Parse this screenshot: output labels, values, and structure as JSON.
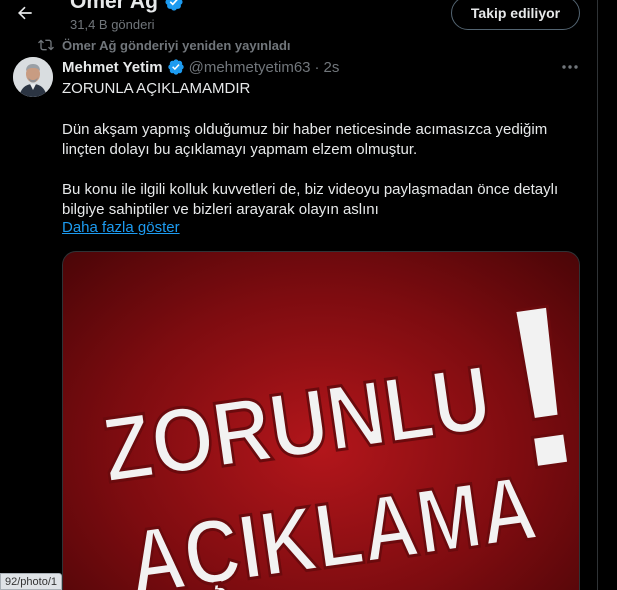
{
  "header": {
    "profile_name": "Ömer Ağ",
    "post_count": "31,4 B gönderi",
    "follow_label": "Takip ediliyor"
  },
  "repost": {
    "text": "Ömer Ağ gönderiyi yeniden yayınladı"
  },
  "tweet": {
    "author_name": "Mehmet Yetim",
    "handle": "@mehmetyetim63",
    "separator": "·",
    "time": "2s",
    "lines": [
      "ZORUNLA AÇIKLAMAMDIR",
      "Dün akşam yapmış olduğumuz bir haber neticesinde  acımasızca yediğim",
      "linçten dolayı bu açıklamayı yapmam elzem olmuştur.",
      "Bu konu ile ilgili kolluk kuvvetleri de, biz videoyu paylaşmadan önce detaylı",
      "bilgiye sahiptiler ve bizleri arayarak olayın aslını"
    ],
    "show_more": "Daha fazla göster"
  },
  "media": {
    "line1": "ZORUNLU",
    "line2": "AÇIKLAMA",
    "exclamation": "!"
  },
  "status_url": "92/photo/1",
  "colors": {
    "accent": "#1d9bf0",
    "verified": "#1d9bf0",
    "muted": "#71767b",
    "media_red": "#9e1015"
  }
}
